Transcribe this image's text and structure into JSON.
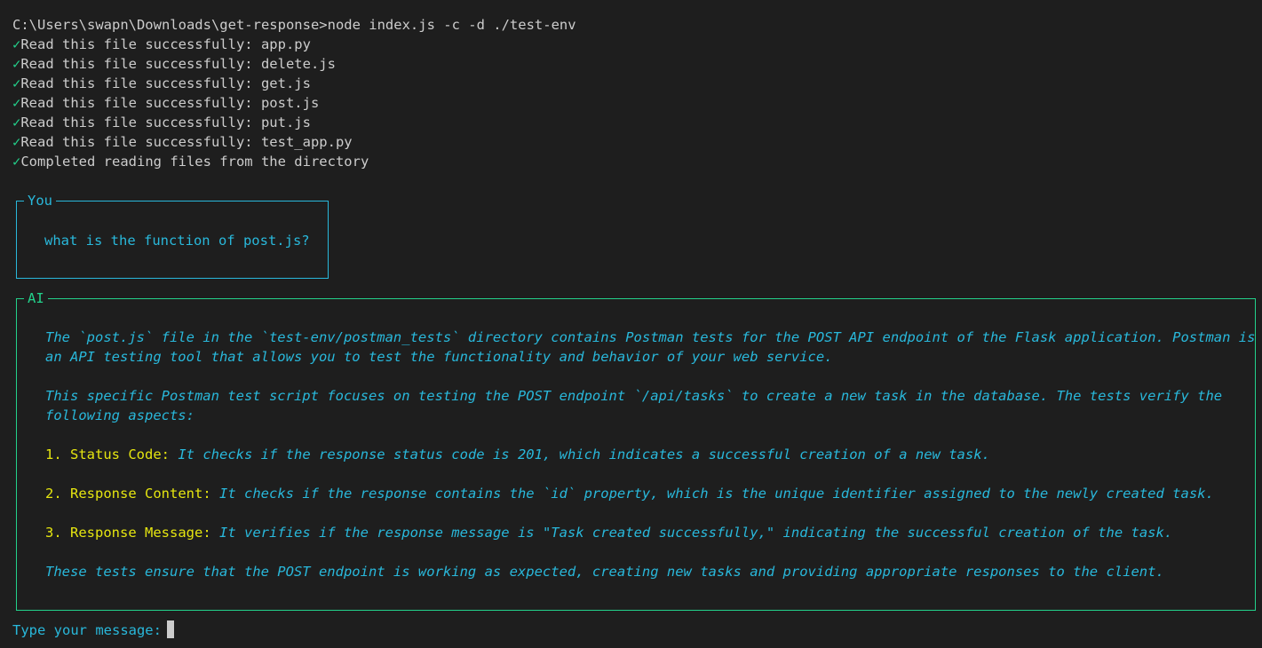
{
  "command_line": "C:\\Users\\swapn\\Downloads\\get-response>node index.js -c -d ./test-env",
  "check_glyph": "✓",
  "read_lines": [
    "Read this file successfully: app.py",
    "Read this file successfully: delete.js",
    "Read this file successfully: get.js",
    "Read this file successfully: post.js",
    "Read this file successfully: put.js",
    "Read this file successfully: test_app.py",
    "Completed reading files from the directory"
  ],
  "you_box": {
    "title": "You",
    "message": "what is the function of post.js?"
  },
  "ai_box": {
    "title": "AI",
    "para1_line1": "The `post.js` file in the `test-env/postman_tests` directory contains Postman tests for the POST API endpoint of the Flask application. Postman is",
    "para1_line2": "an API testing tool that allows you to test the functionality and behavior of your web service.",
    "para2_line1": "This specific Postman test script focuses on testing the POST endpoint `/api/tasks` to create a new task in the database. The tests verify the",
    "para2_line2": "following aspects:",
    "items": [
      {
        "number": "1.",
        "label": "Status Code:",
        "text": "It checks if the response status code is 201, which indicates a successful creation of a new task."
      },
      {
        "number": "2.",
        "label": "Response Content:",
        "text": "It checks if the response contains the `id` property, which is the unique identifier assigned to the newly created task."
      },
      {
        "number": "3.",
        "label": "Response Message:",
        "text": "It verifies if the response message is \"Task created successfully,\" indicating the successful creation of the task."
      }
    ],
    "closing": "These tests ensure that the POST endpoint is working as expected, creating new tasks and providing appropriate responses to the client."
  },
  "prompt": {
    "label": "Type your message:"
  },
  "colors": {
    "background": "#1e1e1e",
    "check_green": "#23d18b",
    "you_cyan": "#29b8db",
    "ai_green": "#23d18b",
    "highlight_yellow": "#e5e510"
  }
}
